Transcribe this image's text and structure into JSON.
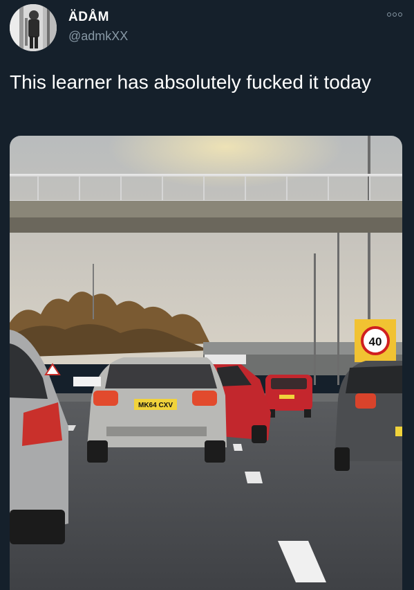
{
  "tweet": {
    "display_name": "ÄDÅM",
    "handle": "@admkXX",
    "text": "This learner has absolutely fucked it today",
    "more_icon": "more-horizontal-icon"
  },
  "media": {
    "plates": {
      "silver_car": "MK64 CXV"
    },
    "speed_sign": "40"
  },
  "colors": {
    "background": "#15202b",
    "text": "#ffffff",
    "secondary": "#8899a6"
  }
}
